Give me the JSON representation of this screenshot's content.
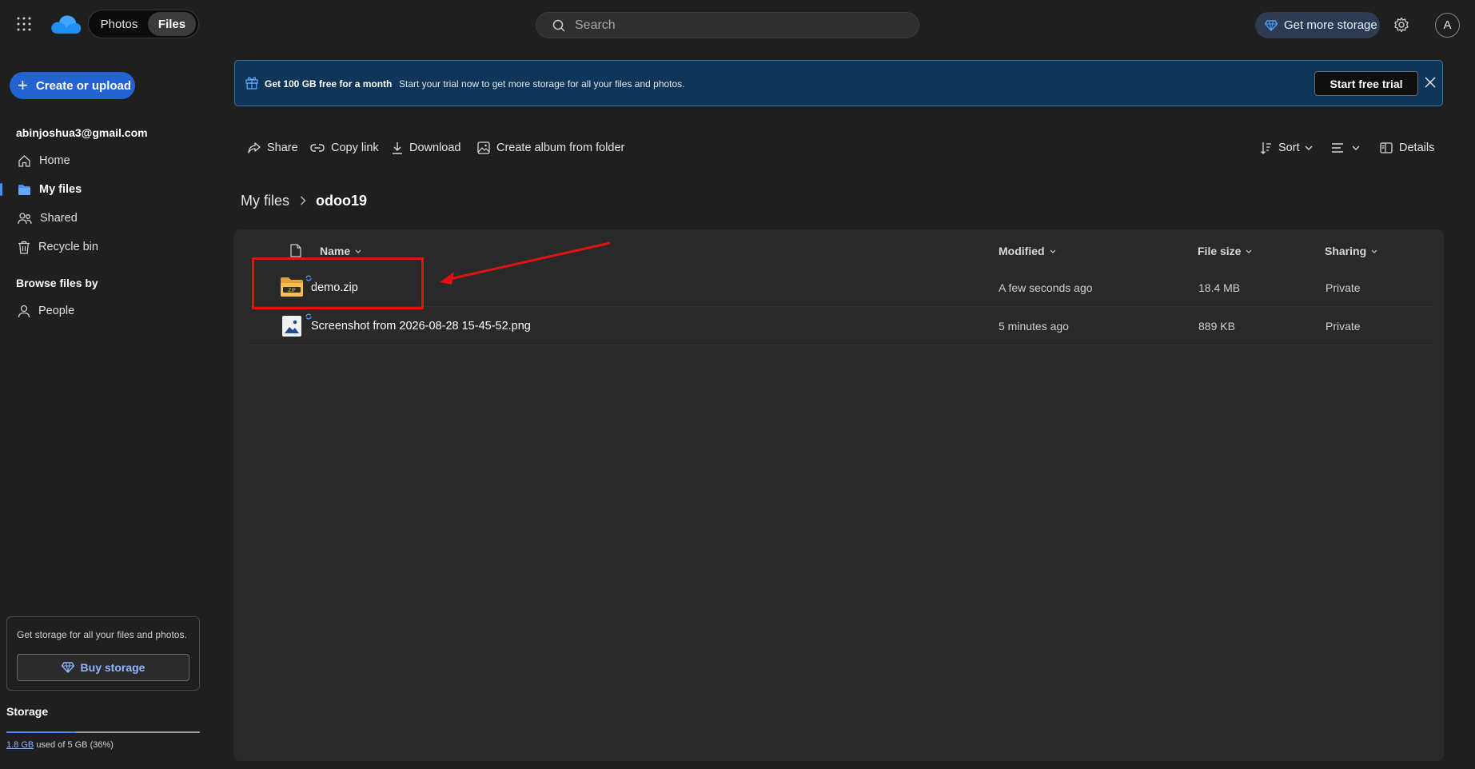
{
  "header": {
    "tabs": [
      {
        "label": "Photos"
      },
      {
        "label": "Files"
      }
    ],
    "search_placeholder": "Search",
    "get_storage_label": "Get more storage",
    "avatar_initial": "A",
    "icons": [
      "waffle-icon",
      "onedrive-logo",
      "search-icon",
      "diamond-icon",
      "gear-icon"
    ]
  },
  "sidebar": {
    "create_label": "Create or upload",
    "email": "abinjoshua3@gmail.com",
    "items": [
      {
        "label": "Home",
        "icon": "home-icon"
      },
      {
        "label": "My files",
        "icon": "folder-icon",
        "active": true
      },
      {
        "label": "Shared",
        "icon": "people-icon"
      },
      {
        "label": "Recycle bin",
        "icon": "trash-icon"
      }
    ],
    "browse_heading": "Browse files by",
    "browse_items": [
      {
        "label": "People",
        "icon": "person-icon"
      }
    ],
    "promo_text": "Get storage for all your files and photos.",
    "buy_label": "Buy storage",
    "storage_heading": "Storage",
    "storage_used": "1.8 GB",
    "storage_rest": "used of 5 GB (36%)",
    "storage_fraction": 0.36
  },
  "banner": {
    "title": "Get 100 GB free for a month",
    "description": "Start your trial now to get more storage for all your files and photos.",
    "cta_label": "Start free trial"
  },
  "commands": [
    {
      "label": "Share",
      "icon": "share-icon"
    },
    {
      "label": "Copy link",
      "icon": "link-icon"
    },
    {
      "label": "Download",
      "icon": "download-icon"
    },
    {
      "label": "Create album from folder",
      "icon": "album-icon"
    }
  ],
  "view_commands": {
    "sort_label": "Sort",
    "details_label": "Details"
  },
  "breadcrumb": {
    "root": "My files",
    "current": "odoo19"
  },
  "table": {
    "columns": [
      "Name",
      "Modified",
      "File size",
      "Sharing"
    ],
    "rows": [
      {
        "name": "demo.zip",
        "modified": "A few seconds ago",
        "size": "18.4 MB",
        "sharing": "Private",
        "icon": "zip-folder-icon"
      },
      {
        "name": "Screenshot from 2026-08-28 15-45-52.png",
        "modified": "5 minutes ago",
        "size": "889 KB",
        "sharing": "Private",
        "icon": "image-file-icon"
      }
    ]
  },
  "colors": {
    "accent": "#2364d2",
    "banner_bg": "#0f3559",
    "annotation": "#e01212"
  }
}
